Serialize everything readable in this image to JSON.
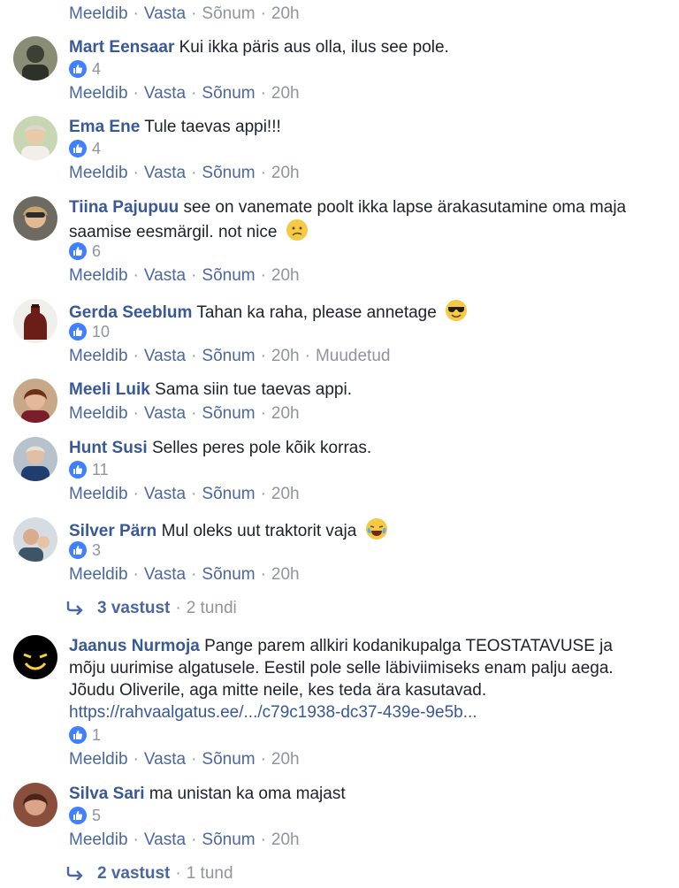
{
  "labels": {
    "like": "Meeldib",
    "reply": "Vasta",
    "message": "Sõnum",
    "sep": "·"
  },
  "top_actions": {
    "time": "20h"
  },
  "comments": [
    {
      "author": "Mart Eensaar",
      "text": "Kui ikka päris aus olla, ilus see pole.",
      "likes": "4",
      "time": "20h"
    },
    {
      "author": "Ema Ene",
      "text": "Tule taevas appi!!!",
      "likes": "4",
      "time": "20h"
    },
    {
      "author": "Tiina Pajupuu",
      "text": "see on vanemate poolt ikka lapse ärakasutamine oma maja saamise eesmärgil. not nice",
      "emoji": "confused-face-emoji",
      "likes": "6",
      "time": "20h"
    },
    {
      "author": "Gerda Seeblum",
      "text": "Tahan ka raha, please annetage",
      "emoji": "sunglasses-face-emoji",
      "likes": "10",
      "time": "20h",
      "edited": "Muudetud"
    },
    {
      "author": "Meeli Luik",
      "text": "Sama siin tue taevas appi.",
      "time": "20h"
    },
    {
      "author": "Hunt Susi",
      "text": "Selles peres pole kõik korras.",
      "likes": "11",
      "time": "20h"
    },
    {
      "author": "Silver Pärn",
      "text": "Mul oleks uut traktorit vaja",
      "emoji": "tears-of-joy-emoji",
      "likes": "3",
      "time": "20h"
    },
    {
      "author": "Jaanus Nurmoja",
      "text": "Pange parem allkiri kodanikupalga TEOSTATAVUSE ja mõju uurimise algatusele. Eestil pole selle läbiviimiseks enam palju aega. Jõudu Oliverile, aga mitte neile, kes teda ära kasutavad.",
      "link": "https://rahvaalgatus.ee/.../c79c1938-dc37-439e-9e5b...",
      "likes": "1",
      "time": "20h"
    },
    {
      "author": "Silva Sari",
      "text": "ma unistan ka oma majast",
      "likes": "5",
      "time": "20h"
    }
  ],
  "replies": [
    {
      "count": "3 vastust",
      "time": "2 tundi"
    },
    {
      "count": "2 vastust",
      "time": "1 tund"
    }
  ],
  "colors": {
    "author": "#385898",
    "action": "#4b67a1",
    "meta": "#90949c",
    "like": "#4080ff"
  }
}
